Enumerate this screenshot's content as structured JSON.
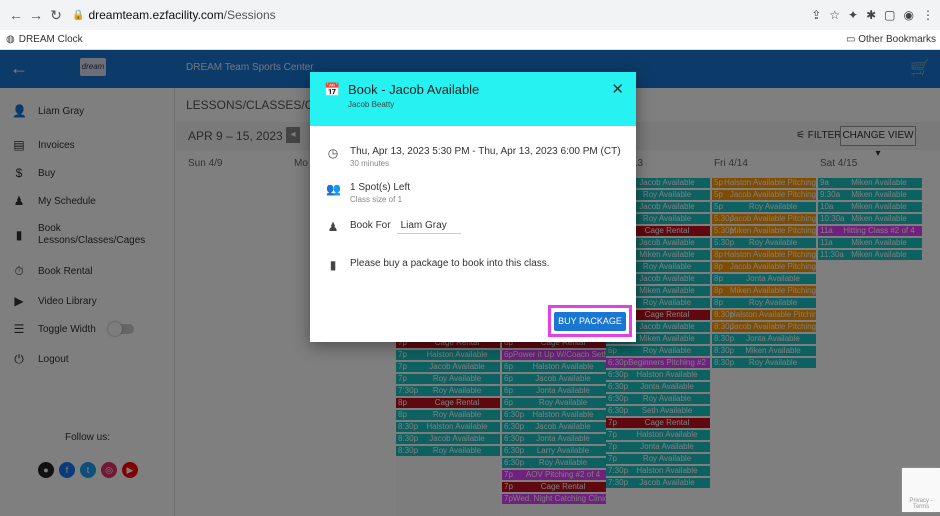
{
  "browser": {
    "url_domain": "dreamteam.ezfacility.com",
    "url_path": "/Sessions",
    "bookmark": "DREAM Clock",
    "other_bookmarks": "Other Bookmarks"
  },
  "topnav": {
    "center_title": "DREAM Team Sports Center",
    "logo_text": "dream"
  },
  "sidebar": {
    "items": [
      {
        "label": "Liam Gray",
        "icon": "avatar-icon"
      },
      {
        "label": "Invoices",
        "icon": "invoice-icon"
      },
      {
        "label": "Buy",
        "icon": "dollar-icon"
      },
      {
        "label": "My Schedule",
        "icon": "person-icon"
      },
      {
        "label": "Book Lessons/Classes/Cages",
        "icon": "book-icon"
      },
      {
        "label": "Book Rental",
        "icon": "stopwatch-icon"
      },
      {
        "label": "Video Library",
        "icon": "video-icon"
      },
      {
        "label": "Toggle Width",
        "icon": "list-icon"
      },
      {
        "label": "Logout",
        "icon": "power-icon"
      }
    ],
    "follow_label": "Follow us:"
  },
  "main": {
    "heading": "LESSONS/CLASSES/CAGE",
    "range": "APR 9 – 15, 2023",
    "filter_label": "FILTER",
    "change_view_label": "CHANGE VIEW ▾",
    "days": [
      "Sun 4/9",
      "Mo",
      "13",
      "Fri 4/14",
      "Sat 4/15"
    ]
  },
  "events": {
    "thu": [
      {
        "t": "",
        "n": "Jacob Available",
        "c": "teal"
      },
      {
        "t": "",
        "n": "Roy Available",
        "c": "teal"
      },
      {
        "t": "",
        "n": "Jacob Available",
        "c": "teal"
      },
      {
        "t": "",
        "n": "Roy Available",
        "c": "teal"
      },
      {
        "t": "",
        "n": "Cage Rental",
        "c": "red"
      },
      {
        "t": "",
        "n": "Jacob Available",
        "c": "teal"
      },
      {
        "t": "",
        "n": "Miken Available",
        "c": "teal"
      },
      {
        "t": "",
        "n": "Roy Available",
        "c": "teal"
      },
      {
        "t": "",
        "n": "Jacob Available",
        "c": "teal"
      },
      {
        "t": "",
        "n": "Miken Available",
        "c": "teal"
      },
      {
        "t": "",
        "n": "Roy Available",
        "c": "teal"
      },
      {
        "t": "",
        "n": "Cage Rental",
        "c": "red"
      },
      {
        "t": "",
        "n": "Jacob Available",
        "c": "teal"
      },
      {
        "t": "6p",
        "n": "Miken Available",
        "c": "teal"
      },
      {
        "t": "6p",
        "n": "Roy Available",
        "c": "teal"
      },
      {
        "t": "6:30p",
        "n": "Beginners Pitching #2",
        "c": "magenta"
      },
      {
        "t": "6:30p",
        "n": "Halston Available",
        "c": "teal"
      },
      {
        "t": "6:30p",
        "n": "Jonta Available",
        "c": "teal"
      },
      {
        "t": "6:30p",
        "n": "Roy Available",
        "c": "teal"
      },
      {
        "t": "6:30p",
        "n": "Seth Available",
        "c": "teal"
      },
      {
        "t": "7p",
        "n": "Cage Rental",
        "c": "red"
      },
      {
        "t": "7p",
        "n": "Halston Available",
        "c": "teal"
      },
      {
        "t": "7p",
        "n": "Jonta Available",
        "c": "teal"
      },
      {
        "t": "7p",
        "n": "Roy Available",
        "c": "teal"
      },
      {
        "t": "7:30p",
        "n": "Halston Available",
        "c": "teal"
      },
      {
        "t": "7:30p",
        "n": "Jacob Available",
        "c": "teal"
      }
    ],
    "fri": [
      {
        "t": "5p",
        "n": "Halston Available Pitching",
        "c": "orange"
      },
      {
        "t": "5p",
        "n": "Jacob Available Pitching",
        "c": "orange"
      },
      {
        "t": "5p",
        "n": "Roy Available",
        "c": "teal"
      },
      {
        "t": "5:30p",
        "n": "Jacob Available Pitching",
        "c": "orange"
      },
      {
        "t": "5:30p",
        "n": "Miken Available Pitching",
        "c": "orange"
      },
      {
        "t": "5:30p",
        "n": "Roy Available",
        "c": "teal"
      },
      {
        "t": "8p",
        "n": "Halston Available Pitching",
        "c": "orange"
      },
      {
        "t": "8p",
        "n": "Jacob Available Pitching",
        "c": "orange"
      },
      {
        "t": "8p",
        "n": "Jonta Available",
        "c": "teal"
      },
      {
        "t": "8p",
        "n": "Miken Available Pitching",
        "c": "orange"
      },
      {
        "t": "8p",
        "n": "Roy Available",
        "c": "teal"
      },
      {
        "t": "8:30p",
        "n": "Halston Available Pitching",
        "c": "orange"
      },
      {
        "t": "8:30p",
        "n": "Jacob Available Pitching",
        "c": "orange"
      },
      {
        "t": "8:30p",
        "n": "Jonta Available",
        "c": "teal"
      },
      {
        "t": "8:30p",
        "n": "Miken Available",
        "c": "teal"
      },
      {
        "t": "8:30p",
        "n": "Roy Available",
        "c": "teal"
      }
    ],
    "sat": [
      {
        "t": "9a",
        "n": "Miken Available",
        "c": "teal"
      },
      {
        "t": "9:30a",
        "n": "Miken Available",
        "c": "teal"
      },
      {
        "t": "10a",
        "n": "Miken Available",
        "c": "teal"
      },
      {
        "t": "10:30a",
        "n": "Miken Available",
        "c": "teal"
      },
      {
        "t": "11a",
        "n": "Hitting Class #2 of 4",
        "c": "magenta"
      },
      {
        "t": "11a",
        "n": "Miken Available",
        "c": "teal"
      },
      {
        "t": "11:30a",
        "n": "Miken Available",
        "c": "teal"
      }
    ],
    "mon": [
      {
        "t": "7p",
        "n": "Cage Rental",
        "c": "red"
      },
      {
        "t": "7p",
        "n": "Halston Available",
        "c": "teal"
      },
      {
        "t": "7p",
        "n": "Jacob Available",
        "c": "teal"
      },
      {
        "t": "7p",
        "n": "Roy Available",
        "c": "teal"
      },
      {
        "t": "7:30p",
        "n": "Roy Available",
        "c": "teal"
      },
      {
        "t": "8p",
        "n": "Cage Rental",
        "c": "red"
      },
      {
        "t": "8p",
        "n": "Roy Available",
        "c": "teal"
      },
      {
        "t": "8:30p",
        "n": "Halston Available",
        "c": "teal"
      },
      {
        "t": "8:30p",
        "n": "Jacob Available",
        "c": "teal"
      },
      {
        "t": "8:30p",
        "n": "Roy Available",
        "c": "teal"
      }
    ],
    "tue": [
      {
        "t": "6p",
        "n": "Cage Rental",
        "c": "red"
      },
      {
        "t": "6p",
        "n": "Power it Up W/Coach Seth",
        "c": "magenta"
      },
      {
        "t": "6p",
        "n": "Halston Available",
        "c": "teal"
      },
      {
        "t": "6p",
        "n": "Jacob Available",
        "c": "teal"
      },
      {
        "t": "6p",
        "n": "Jonta Available",
        "c": "teal"
      },
      {
        "t": "6p",
        "n": "Roy Available",
        "c": "teal"
      },
      {
        "t": "6:30p",
        "n": "Halston Available",
        "c": "teal"
      },
      {
        "t": "6:30p",
        "n": "Jacob Available",
        "c": "teal"
      },
      {
        "t": "6:30p",
        "n": "Jonta Available",
        "c": "teal"
      },
      {
        "t": "6:30p",
        "n": "Larry Available",
        "c": "teal"
      },
      {
        "t": "6:30p",
        "n": "Roy Available",
        "c": "teal"
      },
      {
        "t": "7p",
        "n": "AOV Pitching #2 of 4",
        "c": "magenta"
      },
      {
        "t": "7p",
        "n": "Cage Rental",
        "c": "red"
      },
      {
        "t": "7p",
        "n": "Wed. Night Catching Clinic",
        "c": "magenta"
      }
    ]
  },
  "modal": {
    "title": "Book - Jacob Available",
    "subtitle": "Jacob Beatty",
    "datetime": "Thu, Apr 13, 2023 5:30 PM - Thu, Apr 13, 2023 6:00 PM (CT)",
    "duration": "30 minutes",
    "spots": "1 Spot(s) Left",
    "class_size": "Class size of 1",
    "book_for_label": "Book For",
    "book_for_value": "Liam Gray",
    "message": "Please buy a package to book into this class.",
    "buy_label": "BUY PACKAGE"
  },
  "recaptcha_text": "Privacy - Terms",
  "colors": {
    "primary": "#1976d2",
    "modal_header": "#27f2f2",
    "highlight": "#e53fe8",
    "teal": "#1bc3c3",
    "red": "#c0101e",
    "orange": "#ff9800",
    "magenta": "#e040fb"
  }
}
